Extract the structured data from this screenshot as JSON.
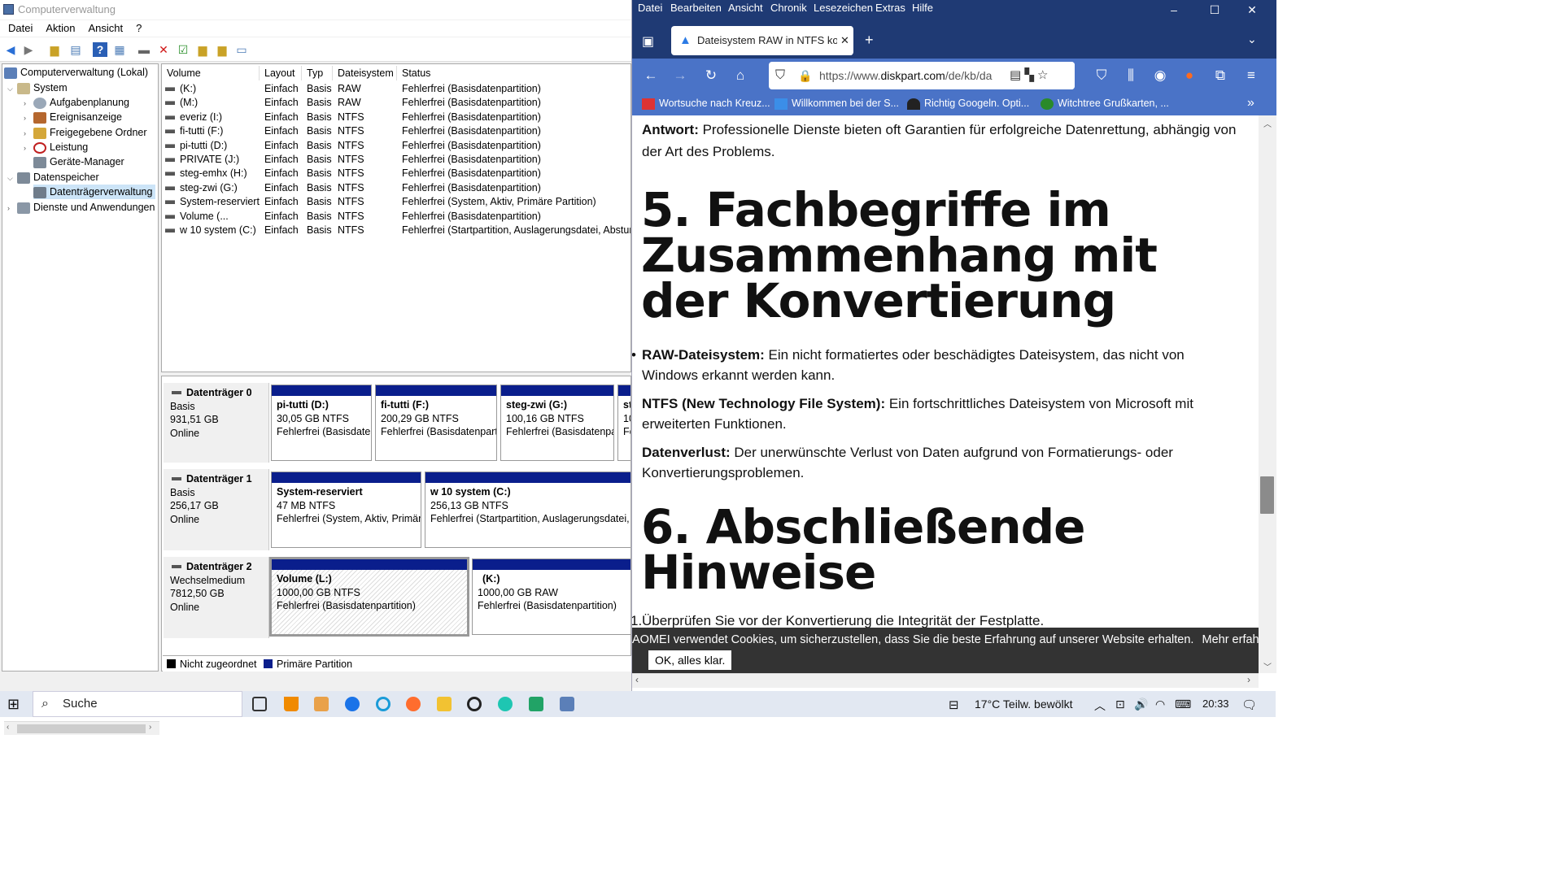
{
  "cm": {
    "title": "Computerverwaltung",
    "menu": [
      "Datei",
      "Aktion",
      "Ansicht",
      "?"
    ],
    "tree": [
      {
        "label": "Computerverwaltung (Lokal)",
        "icon": "computer-management-icon"
      },
      {
        "label": "System",
        "icon": "tools-icon"
      },
      {
        "label": "Aufgabenplanung",
        "icon": "clock-icon"
      },
      {
        "label": "Ereignisanzeige",
        "icon": "event-viewer-icon"
      },
      {
        "label": "Freigegebene Ordner",
        "icon": "shared-folder-icon"
      },
      {
        "label": "Leistung",
        "icon": "performance-icon"
      },
      {
        "label": "Geräte-Manager",
        "icon": "device-manager-icon"
      },
      {
        "label": "Datenspeicher",
        "icon": "storage-icon"
      },
      {
        "label": "Datenträgerverwaltung",
        "icon": "disk-management-icon"
      },
      {
        "label": "Dienste und Anwendungen",
        "icon": "services-icon"
      }
    ],
    "columns": [
      "Volume",
      "Layout",
      "Typ",
      "Dateisystem",
      "Status"
    ],
    "volumes": [
      {
        "name": "(K:)",
        "layout": "Einfach",
        "type": "Basis",
        "fs": "RAW",
        "status": "Fehlerfrei (Basisdatenpartition)"
      },
      {
        "name": "(M:)",
        "layout": "Einfach",
        "type": "Basis",
        "fs": "RAW",
        "status": "Fehlerfrei (Basisdatenpartition)"
      },
      {
        "name": "everiz (I:)",
        "layout": "Einfach",
        "type": "Basis",
        "fs": "NTFS",
        "status": "Fehlerfrei (Basisdatenpartition)"
      },
      {
        "name": "fi-tutti (F:)",
        "layout": "Einfach",
        "type": "Basis",
        "fs": "NTFS",
        "status": "Fehlerfrei (Basisdatenpartition)"
      },
      {
        "name": "pi-tutti (D:)",
        "layout": "Einfach",
        "type": "Basis",
        "fs": "NTFS",
        "status": "Fehlerfrei (Basisdatenpartition)"
      },
      {
        "name": "PRIVATE (J:)",
        "layout": "Einfach",
        "type": "Basis",
        "fs": "NTFS",
        "status": "Fehlerfrei (Basisdatenpartition)"
      },
      {
        "name": "steg-emhx (H:)",
        "layout": "Einfach",
        "type": "Basis",
        "fs": "NTFS",
        "status": "Fehlerfrei (Basisdatenpartition)"
      },
      {
        "name": "steg-zwi (G:)",
        "layout": "Einfach",
        "type": "Basis",
        "fs": "NTFS",
        "status": "Fehlerfrei (Basisdatenpartition)"
      },
      {
        "name": "System-reserviert",
        "layout": "Einfach",
        "type": "Basis",
        "fs": "NTFS",
        "status": "Fehlerfrei (System, Aktiv, Primäre Partition)"
      },
      {
        "name": "Volume (...",
        "layout": "Einfach",
        "type": "Basis",
        "fs": "NTFS",
        "status": "Fehlerfrei (Basisdatenpartition)"
      },
      {
        "name": "w 10 system (C:)",
        "layout": "Einfach",
        "type": "Basis",
        "fs": "NTFS",
        "status": "Fehlerfrei (Startpartition, Auslagerungsdatei, Absturz"
      }
    ],
    "disks": [
      {
        "name": "Datenträger 0",
        "kind": "Basis",
        "size": "931,51 GB",
        "state": "Online",
        "parts": [
          {
            "name": "pi-tutti  (D:)",
            "size": "30,05 GB NTFS",
            "status": "Fehlerfrei (Basisdater"
          },
          {
            "name": "fi-tutti  (F:)",
            "size": "200,29 GB NTFS",
            "status": "Fehlerfrei (Basisdatenpart"
          },
          {
            "name": "steg-zwi  (G:)",
            "size": "100,16 GB NTFS",
            "status": "Fehlerfrei (Basisdatenpa"
          },
          {
            "name": "st",
            "size": "10",
            "status": "Fe"
          }
        ]
      },
      {
        "name": "Datenträger 1",
        "kind": "Basis",
        "size": "256,17 GB",
        "state": "Online",
        "parts": [
          {
            "name": "System-reserviert",
            "size": "47 MB NTFS",
            "status": "Fehlerfrei (System, Aktiv, Primär"
          },
          {
            "name": "w 10 system  (C:)",
            "size": "256,13 GB NTFS",
            "status": "Fehlerfrei (Startpartition, Auslagerungsdatei, A"
          }
        ]
      },
      {
        "name": "Datenträger 2",
        "kind": "Wechselmedium",
        "size": "7812,50 GB",
        "state": "Online",
        "parts": [
          {
            "name": "Volume  (L:)",
            "size": "1000,00 GB NTFS",
            "status": "Fehlerfrei (Basisdatenpartition)"
          },
          {
            "name": "(K:)",
            "size": "1000,00 GB RAW",
            "status": "Fehlerfrei (Basisdatenpartition)"
          }
        ]
      }
    ],
    "legend": {
      "unallocated": "Nicht zugeordnet",
      "primary": "Primäre Partition"
    }
  },
  "ff": {
    "menu": [
      "Datei",
      "Bearbeiten",
      "Ansicht",
      "Chronik",
      "Lesezeichen",
      "Extras",
      "Hilfe"
    ],
    "tab_title": "Dateisystem RAW in NTFS konv",
    "url_prefix": "https://www.",
    "url_domain": "diskpart.com",
    "url_rest": "/de/kb/da",
    "bookmarks": [
      "Wortsuche nach Kreuz...",
      "Willkommen bei der S...",
      "Richtig Googeln. Opti...",
      "Witchtree Grußkarten, ..."
    ],
    "content": {
      "answer_label": "Antwort:",
      "answer_text": " Professionelle Dienste bieten oft Garantien für erfolgreiche Datenrettung, abhängig von der Art des Problems.",
      "h5": "5. Fachbegriffe im Zusammenhang mit der Konvertierung",
      "terms": [
        {
          "term": "RAW-Dateisystem:",
          "desc": " Ein nicht formatiertes oder beschädigtes Dateisystem, das nicht von Windows erkannt werden kann."
        },
        {
          "term": "NTFS (New Technology File System):",
          "desc": " Ein fortschrittliches Dateisystem von Microsoft mit erweiterten Funktionen."
        },
        {
          "term": "Datenverlust:",
          "desc": " Der unerwünschte Verlust von Daten aufgrund von Formatierungs- oder Konvertierungsproblemen."
        }
      ],
      "h6": "6. Abschließende Hinweise",
      "list_item": "Überprüfen Sie vor der Konvertierung die Integrität der Festplatte."
    },
    "cookie": {
      "text": "AOMEI verwendet Cookies, um sicherzustellen, dass Sie die beste Erfahrung auf unserer Website erhalten.",
      "more": "Mehr erfahren",
      "ok": "OK, alles klar."
    }
  },
  "taskbar": {
    "search_placeholder": "Suche",
    "weather": "17°C  Teilw. bewölkt",
    "time": "20:33"
  }
}
